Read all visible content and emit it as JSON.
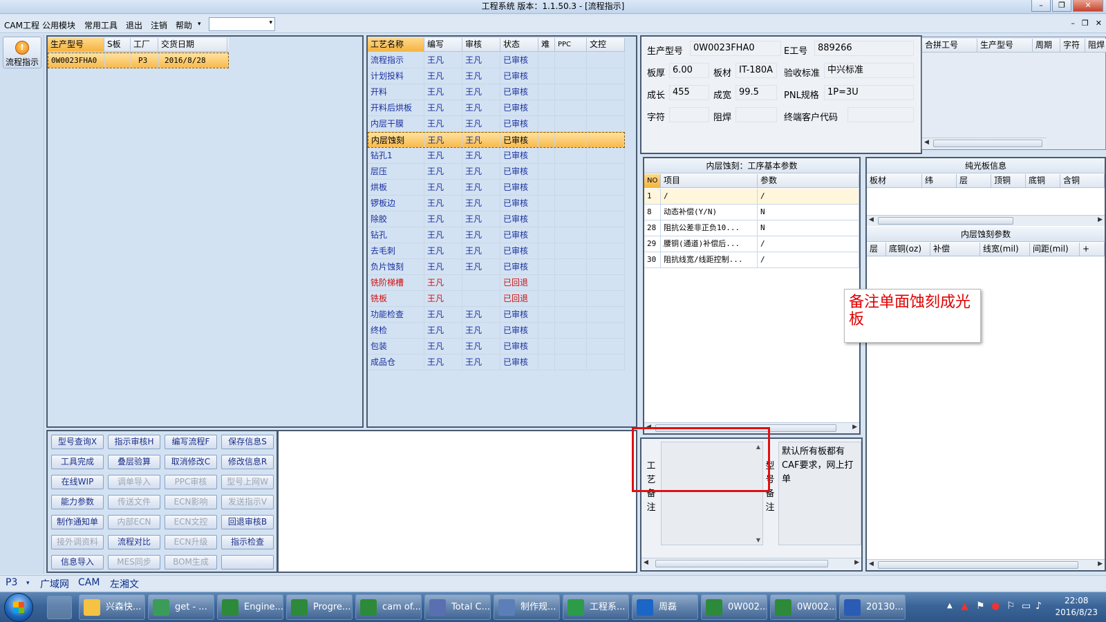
{
  "window": {
    "title": "工程系统  版本：1.1.50.3 - [流程指示]"
  },
  "menu": {
    "items": [
      "CAM工程",
      "公用模块",
      "常用工具",
      "退出",
      "注销",
      "帮助"
    ]
  },
  "left_strip": {
    "flow_button": "流程指示"
  },
  "order_grid": {
    "columns": [
      "生产型号",
      "S板",
      "工厂",
      "交货日期"
    ],
    "rows": [
      [
        "0W0023FHA0",
        "",
        "P3",
        "2016/8/28"
      ]
    ]
  },
  "process_grid": {
    "columns": [
      "工艺名称",
      "编写",
      "审核",
      "状态",
      "难",
      "PPC",
      "文控"
    ],
    "rows": [
      {
        "name": "流程指示",
        "writer": "王凡",
        "reviewer": "王凡",
        "status": "已审核",
        "color": "blue"
      },
      {
        "name": "计划投料",
        "writer": "王凡",
        "reviewer": "王凡",
        "status": "已审核",
        "color": "blue"
      },
      {
        "name": "开料",
        "writer": "王凡",
        "reviewer": "王凡",
        "status": "已审核",
        "color": "blue"
      },
      {
        "name": "开料后烘板",
        "writer": "王凡",
        "reviewer": "王凡",
        "status": "已审核",
        "color": "blue"
      },
      {
        "name": "内层干膜",
        "writer": "王凡",
        "reviewer": "王凡",
        "status": "已审核",
        "color": "blue"
      },
      {
        "name": "内层蚀刻",
        "writer": "王凡",
        "reviewer": "王凡",
        "status": "已审核",
        "color": "sel"
      },
      {
        "name": "钻孔1",
        "writer": "王凡",
        "reviewer": "王凡",
        "status": "已审核",
        "color": "blue"
      },
      {
        "name": "层压",
        "writer": "王凡",
        "reviewer": "王凡",
        "status": "已审核",
        "color": "blue"
      },
      {
        "name": "烘板",
        "writer": "王凡",
        "reviewer": "王凡",
        "status": "已审核",
        "color": "blue"
      },
      {
        "name": "锣板边",
        "writer": "王凡",
        "reviewer": "王凡",
        "status": "已审核",
        "color": "blue"
      },
      {
        "name": "除胶",
        "writer": "王凡",
        "reviewer": "王凡",
        "status": "已审核",
        "color": "blue"
      },
      {
        "name": "钻孔",
        "writer": "王凡",
        "reviewer": "王凡",
        "status": "已审核",
        "color": "blue"
      },
      {
        "name": "去毛刺",
        "writer": "王凡",
        "reviewer": "王凡",
        "status": "已审核",
        "color": "blue"
      },
      {
        "name": "负片蚀刻",
        "writer": "王凡",
        "reviewer": "王凡",
        "status": "已审核",
        "color": "blue"
      },
      {
        "name": "铣阶梯槽",
        "writer": "王凡",
        "reviewer": "",
        "status": "已回退",
        "color": "red"
      },
      {
        "name": "铣板",
        "writer": "王凡",
        "reviewer": "",
        "status": "已回退",
        "color": "red"
      },
      {
        "name": "功能检查",
        "writer": "王凡",
        "reviewer": "王凡",
        "status": "已审核",
        "color": "blue"
      },
      {
        "name": "终检",
        "writer": "王凡",
        "reviewer": "王凡",
        "status": "已审核",
        "color": "blue"
      },
      {
        "name": "包装",
        "writer": "王凡",
        "reviewer": "王凡",
        "status": "已审核",
        "color": "blue"
      },
      {
        "name": "成品仓",
        "writer": "王凡",
        "reviewer": "王凡",
        "status": "已审核",
        "color": "blue"
      }
    ]
  },
  "buttons": [
    [
      "型号查询X",
      "指示审核H",
      "编写流程F",
      "保存信息S"
    ],
    [
      "工具完成",
      "叠层验算",
      "取消修改C",
      "修改信息R"
    ],
    [
      "在线WIP",
      "调单导入",
      "PPC审核",
      "型号上网W"
    ],
    [
      "能力参数",
      "传送文件",
      "ECN影响",
      "发送指示V"
    ],
    [
      "制作通知单",
      "内部ECN",
      "ECN文控",
      "回退审核B"
    ],
    [
      "接外调资料",
      "流程对比",
      "ECN升级",
      "指示检查"
    ],
    [
      "信息导入",
      "MES同步",
      "BOM生成",
      ""
    ]
  ],
  "buttons_disabled": [
    [
      0,
      0,
      0,
      0
    ],
    [
      0,
      0,
      0,
      0
    ],
    [
      0,
      1,
      1,
      1
    ],
    [
      0,
      1,
      1,
      1
    ],
    [
      0,
      1,
      1,
      0
    ],
    [
      1,
      0,
      1,
      0
    ],
    [
      0,
      1,
      1,
      0
    ]
  ],
  "info": {
    "model_label": "生产型号",
    "model": "0W0023FHA0",
    "eno_label": "E工号",
    "eno": "889266",
    "thick_label": "板厚",
    "thick": "6.00",
    "mat_label": "板材",
    "mat": "IT-180A",
    "std_label": "验收标准",
    "std": "中兴标准",
    "len_label": "成长",
    "len": "455",
    "wid_label": "成宽",
    "wid": "99.5",
    "pnl_label": "PNL规格",
    "pnl": "1P=3U",
    "char_label": "字符",
    "char": "",
    "mask_label": "阻焊",
    "mask": "",
    "cust_label": "终端客户代码",
    "cust": ""
  },
  "merge_grid": {
    "columns": [
      "合拼工号",
      "生产型号",
      "周期",
      "字符",
      "阻焊"
    ]
  },
  "params": {
    "title": "内层蚀刻：工序基本参数",
    "columns": [
      "NO",
      "项目",
      "参数"
    ],
    "rows": [
      [
        "1",
        "/",
        "/"
      ],
      [
        "8",
        "动态补偿(Y/N)",
        "N"
      ],
      [
        "28",
        "阻抗公差非正负10...",
        "N"
      ],
      [
        "29",
        "腰铜(通道)补偿后...",
        "/"
      ],
      [
        "30",
        "阻抗线宽/线距控制...",
        "/"
      ]
    ]
  },
  "bare_board": {
    "title": "纯光板信息",
    "columns": [
      "板材",
      "纬",
      "层",
      "顶铜",
      "底铜",
      "含铜"
    ]
  },
  "inner_etch": {
    "title": "内层蚀刻参数",
    "columns": [
      "层",
      "底铜(oz)",
      "补偿",
      "线宽(mil)",
      "间距(mil)",
      "+"
    ]
  },
  "remarks": {
    "process_label": "工艺备注",
    "model_label": "型号备注",
    "model_text": "默认所有板都有CAF要求，网上打单"
  },
  "annotation": "备注单面蚀刻成光板",
  "statusbar": {
    "factory": "P3",
    "items": [
      "广域网",
      "CAM",
      "左湘文"
    ]
  },
  "taskbar": {
    "items": [
      "兴森快...",
      "get - ...",
      "Engine...",
      "Progre...",
      "cam of...",
      "Total C...",
      "制作规...",
      "工程系...",
      "周磊",
      "0W002...",
      "0W002...",
      "20130..."
    ],
    "time": "22:08",
    "date": "2016/8/23"
  }
}
